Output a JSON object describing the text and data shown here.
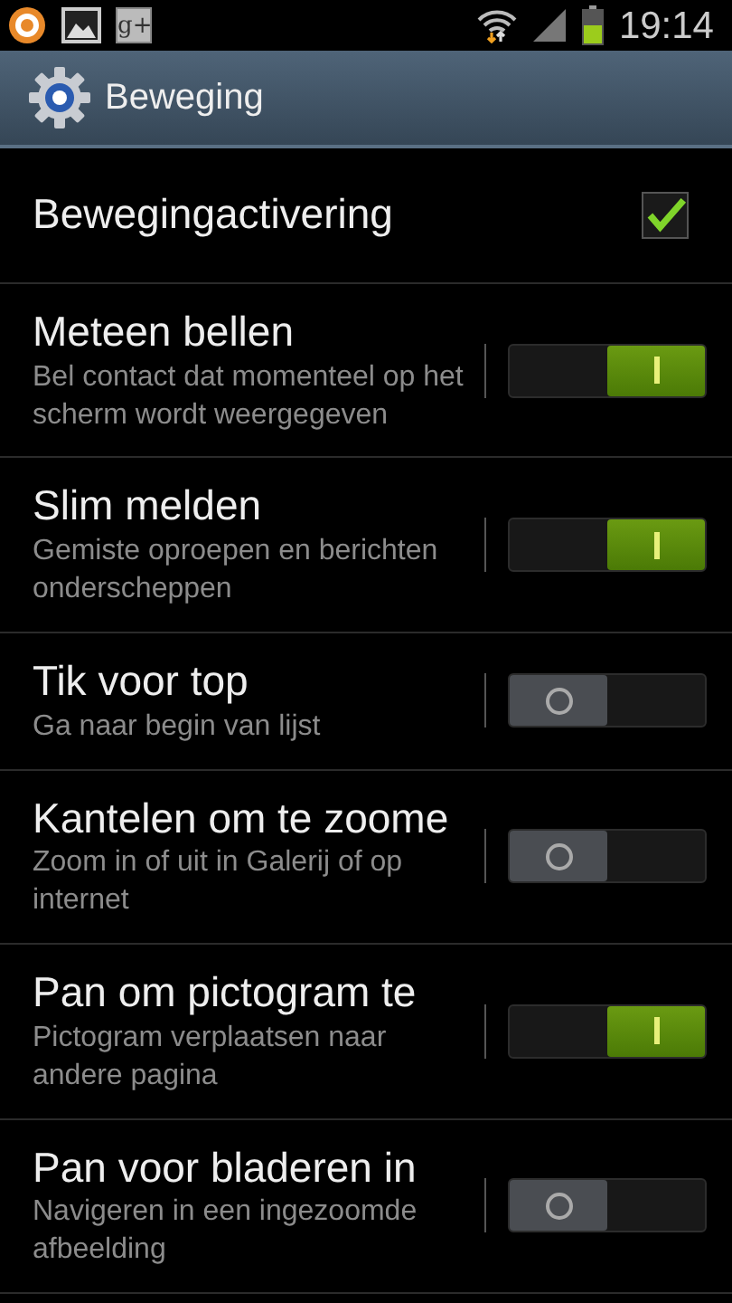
{
  "status_bar": {
    "notifications": [
      {
        "kind": "ring"
      },
      {
        "kind": "image"
      },
      {
        "kind": "label",
        "text": "g+"
      }
    ],
    "time": "19:14"
  },
  "action_bar": {
    "title": "Beweging"
  },
  "settings": [
    {
      "kind": "checkbox",
      "title": "Bewegingactivering",
      "checked": true
    },
    {
      "kind": "switch",
      "title": "Meteen bellen",
      "summary": "Bel contact dat momenteel op het scherm wordt weergegeven",
      "on": true
    },
    {
      "kind": "switch",
      "title": "Slim melden",
      "summary": "Gemiste oproepen en berichten onderscheppen",
      "on": true
    },
    {
      "kind": "switch",
      "title": "Tik voor top",
      "summary": "Ga naar begin van lijst",
      "on": false
    },
    {
      "kind": "switch",
      "title": "Kantelen om te zoome",
      "summary": "Zoom in of uit in Galerij of op internet",
      "on": false
    },
    {
      "kind": "switch",
      "title": "Pan om pictogram te",
      "summary": "Pictogram verplaatsen naar andere pagina",
      "on": true
    },
    {
      "kind": "switch",
      "title": "Pan voor bladeren in",
      "summary": "Navigeren in een ingezoomde afbeelding",
      "on": false
    }
  ]
}
